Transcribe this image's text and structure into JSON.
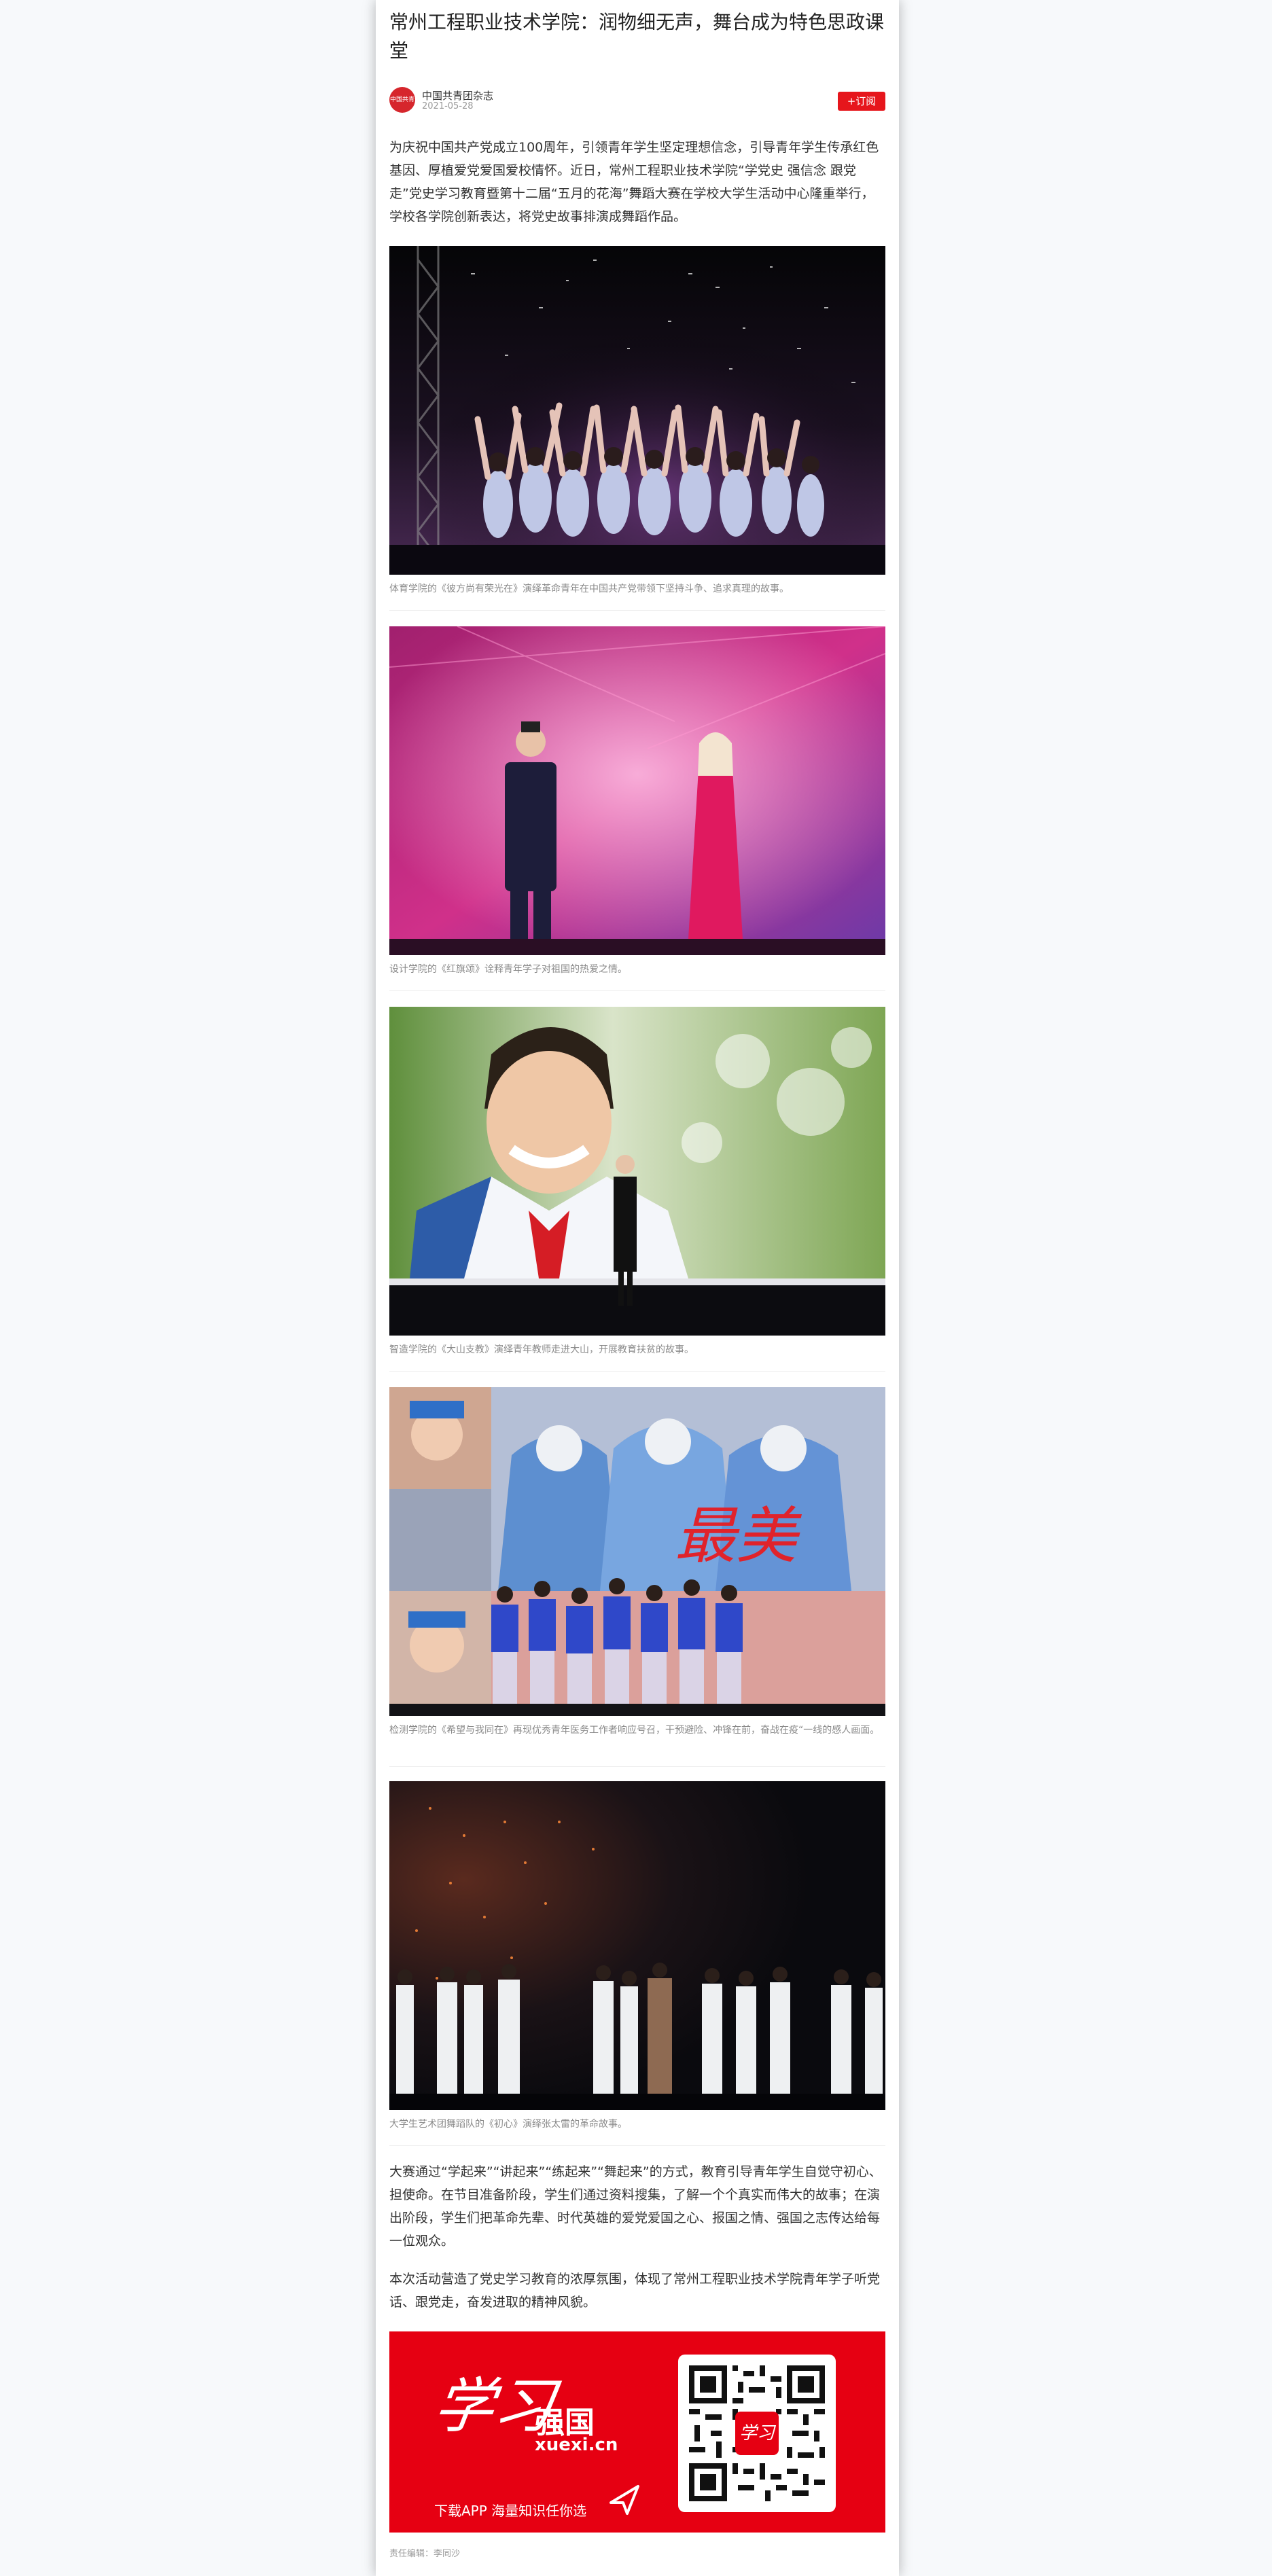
{
  "article": {
    "title": "常州工程职业技术学院：润物细无声，舞台成为特色思政课堂",
    "source": {
      "avatar_text": "中国共青团",
      "name": "中国共青团杂志",
      "date": "2021-05-28"
    },
    "subscribe_label": "+订阅",
    "intro": "为庆祝中国共产党成立100周年，引领青年学生坚定理想信念，引导青年学生传承红色基因、厚植爱党爱国爱校情怀。近日，常州工程职业技术学院“学党史 强信念 跟党走”党史学习教育暨第十二届“五月的花海”舞蹈大赛在学校大学生活动中心隆重举行，学校各学院创新表达，将党史故事排演成舞蹈作品。",
    "photos": [
      {
        "name": "photo-dance-performance",
        "caption": "体育学院的《彼方尚有荣光在》演绎革命青年在中国共产党带领下坚持斗争、追求真理的故事。"
      },
      {
        "name": "photo-red-flag-hosts",
        "caption": "设计学院的《红旗颂》诠释青年学子对祖国的热爱之情。"
      },
      {
        "name": "photo-mountain-teacher",
        "caption": "智造学院的《大山支教》演绎青年教师走进大山，开展教育扶贫的故事。"
      },
      {
        "name": "photo-medical-heroes",
        "caption": "检测学院的《希望与我同在》再现优秀青年医务工作者响应号召，干预避险、冲锋在前，奋战在疫“一线的感人画面。"
      },
      {
        "name": "photo-original-heart",
        "caption": "大学生艺术团舞蹈队的《初心》演绎张太雷的革命故事。"
      }
    ],
    "paragraphs": [
      "大赛通过“学起来”“讲起来”“练起来”“舞起来”的方式，教育引导青年学生自觉守初心、担使命。在节目准备阶段，学生们通过资料搜集，了解一个个真实而伟大的故事；在演出阶段，学生们把革命先辈、时代英雄的爱党爱国之心、报国之情、强国之志传达给每一位观众。",
      "本次活动营造了党史学习教育的浓厚氛围，体现了常州工程职业技术学院青年学子听党话、跟党走，奋发进取的精神风貌。"
    ],
    "banner": {
      "script_text": "学习",
      "name_text": "强国",
      "url_text": "xuexi.cn",
      "slogan": "下载APP 海量知识任你选",
      "qr_logo_text": "学习"
    },
    "editor": "责任编辑：李同沙"
  },
  "colors": {
    "accent": "#e6161c",
    "banner_red": "#e60012"
  }
}
